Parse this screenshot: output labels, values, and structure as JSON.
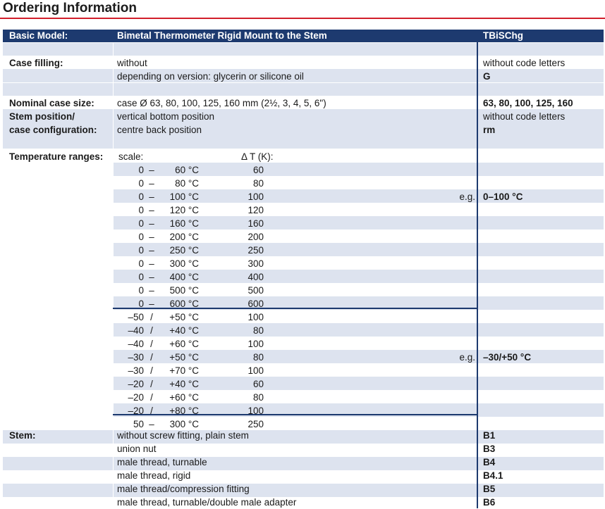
{
  "title": "Ordering Information",
  "header": {
    "basic_model_label": "Basic Model:",
    "description": "Bimetal Thermometer Rigid Mount to the Stem",
    "code": "TBiSChg"
  },
  "case_filling": {
    "label": "Case filling:",
    "options": [
      {
        "text": "without",
        "code": "without code letters"
      },
      {
        "text": "depending on version: glycerin or silicone oil",
        "code": "G"
      }
    ]
  },
  "nominal_case_size": {
    "label": "Nominal case size:",
    "text": "case Ø 63, 80, 100, 125, 160 mm (2½, 3, 4, 5, 6\")",
    "code": "63, 80, 100, 125, 160"
  },
  "stem_position": {
    "label_line1": "Stem position/",
    "label_line2": "case configuration:",
    "options": [
      {
        "text": "vertical bottom position",
        "code": "without code letters"
      },
      {
        "text": "centre back position",
        "code": "rm"
      }
    ]
  },
  "temperature_ranges": {
    "label": "Temperature ranges:",
    "scale_label": "scale:",
    "delta_label": "Δ T (K):",
    "ranges_a": [
      {
        "from": "0",
        "sep": "–",
        "to": "60 °C",
        "delta": "60"
      },
      {
        "from": "0",
        "sep": "–",
        "to": "80 °C",
        "delta": "80"
      },
      {
        "from": "0",
        "sep": "–",
        "to": "100 °C",
        "delta": "100",
        "eg": "e.g.",
        "example": "0–100 °C"
      },
      {
        "from": "0",
        "sep": "–",
        "to": "120 °C",
        "delta": "120"
      },
      {
        "from": "0",
        "sep": "–",
        "to": "160 °C",
        "delta": "160"
      },
      {
        "from": "0",
        "sep": "–",
        "to": "200 °C",
        "delta": "200"
      },
      {
        "from": "0",
        "sep": "–",
        "to": "250 °C",
        "delta": "250"
      },
      {
        "from": "0",
        "sep": "–",
        "to": "300 °C",
        "delta": "300"
      },
      {
        "from": "0",
        "sep": "–",
        "to": "400 °C",
        "delta": "400"
      },
      {
        "from": "0",
        "sep": "–",
        "to": "500 °C",
        "delta": "500"
      },
      {
        "from": "0",
        "sep": "–",
        "to": "600 °C",
        "delta": "600"
      }
    ],
    "ranges_b": [
      {
        "from": "–50",
        "sep": "/",
        "to": "+50 °C",
        "delta": "100"
      },
      {
        "from": "–40",
        "sep": "/",
        "to": "+40 °C",
        "delta": "80"
      },
      {
        "from": "–40",
        "sep": "/",
        "to": "+60 °C",
        "delta": "100"
      },
      {
        "from": "–30",
        "sep": "/",
        "to": "+50 °C",
        "delta": "80",
        "eg": "e.g.",
        "example": "–30/+50 °C"
      },
      {
        "from": "–30",
        "sep": "/",
        "to": "+70 °C",
        "delta": "100"
      },
      {
        "from": "–20",
        "sep": "/",
        "to": "+40 °C",
        "delta": "60"
      },
      {
        "from": "–20",
        "sep": "/",
        "to": "+60 °C",
        "delta": "80"
      },
      {
        "from": "–20",
        "sep": "/",
        "to": "+80 °C",
        "delta": "100"
      }
    ],
    "ranges_c": [
      {
        "from": "50",
        "sep": "–",
        "to": "300 °C",
        "delta": "250"
      }
    ]
  },
  "stem": {
    "label": "Stem:",
    "options": [
      {
        "text": "without screw fitting, plain stem",
        "code": "B1"
      },
      {
        "text": "union nut",
        "code": "B3"
      },
      {
        "text": "male thread, turnable",
        "code": "B4"
      },
      {
        "text": "male thread, rigid",
        "code": "B4.1"
      },
      {
        "text": "male thread/compression fitting",
        "code": "B5"
      },
      {
        "text": "male thread, turnable/double male adapter",
        "code": "B6"
      }
    ]
  },
  "colors": {
    "accent_red": "#d21e2b",
    "navy": "#1d3a6f",
    "band": "#dde3ef"
  }
}
